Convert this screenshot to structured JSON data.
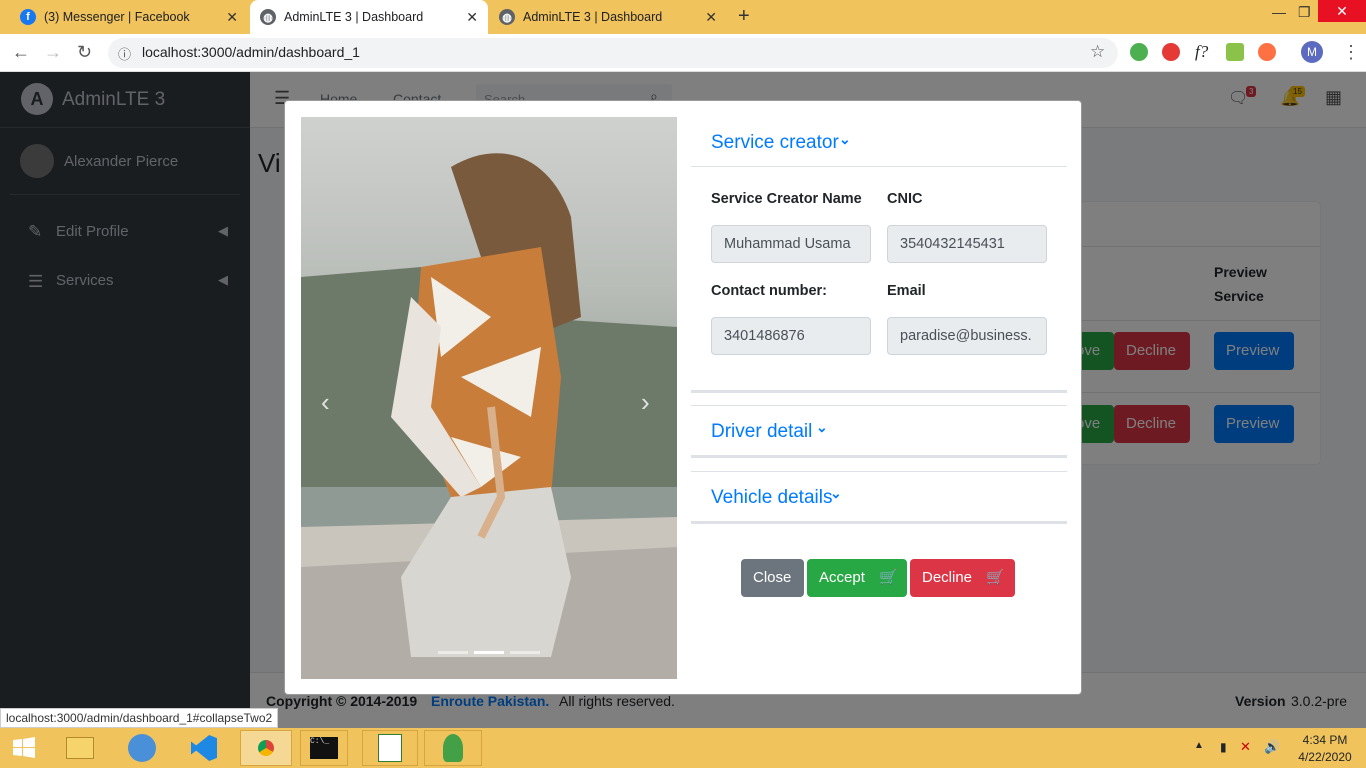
{
  "browser": {
    "tabs": [
      {
        "title": "(3) Messenger | Facebook",
        "icon": "facebook-icon"
      },
      {
        "title": "AdminLTE 3 | Dashboard",
        "icon": "globe-icon"
      },
      {
        "title": "AdminLTE 3 | Dashboard",
        "icon": "globe-icon"
      }
    ],
    "url": "localhost:3000/admin/dashboard_1",
    "profile_initial": "M",
    "status_url": "localhost:3000/admin/dashboard_1#collapseTwo2"
  },
  "sidebar": {
    "brand": "AdminLTE 3",
    "user": "Alexander Pierce",
    "items": [
      {
        "label": "Edit Profile",
        "icon": "edit-icon"
      },
      {
        "label": "Services",
        "icon": "list-icon"
      }
    ]
  },
  "topnav": {
    "links": [
      "Home",
      "Contact"
    ],
    "search_placeholder": "Search",
    "messages_badge": "3",
    "notifications_badge": "15"
  },
  "content": {
    "title_fragment": "Vi",
    "table_header": "Preview Service",
    "rows": [
      {
        "approve": "ove",
        "decline": "Decline",
        "preview": "Preview"
      },
      {
        "approve": "ove",
        "decline": "Decline",
        "preview": "Preview"
      }
    ]
  },
  "footer": {
    "copyright": "Copyright © 2014-2019",
    "company": "Enroute Pakistan.",
    "rights": "All rights reserved.",
    "version_label": "Version",
    "version": "3.0.2-pre"
  },
  "modal": {
    "service_creator": {
      "title": "Service creator",
      "name_label": "Service Creator Name",
      "name_value": "Muhammad Usama",
      "cnic_label": "CNIC",
      "cnic_value": "3540432145431",
      "contact_label": "Contact number:",
      "contact_value": "3401486876",
      "email_label": "Email",
      "email_value": "paradise@business."
    },
    "driver_title": "Driver detail",
    "vehicle_title": "Vehicle details",
    "buttons": {
      "close": "Close",
      "accept": "Accept",
      "decline": "Decline"
    }
  },
  "taskbar": {
    "time": "4:34 PM",
    "date": "4/22/2020"
  },
  "colors": {
    "primary": "#007bff",
    "success": "#28a745",
    "danger": "#dc3545",
    "secondary": "#6c757d",
    "sidebar": "#343a40",
    "chrome": "#f1c35c"
  }
}
